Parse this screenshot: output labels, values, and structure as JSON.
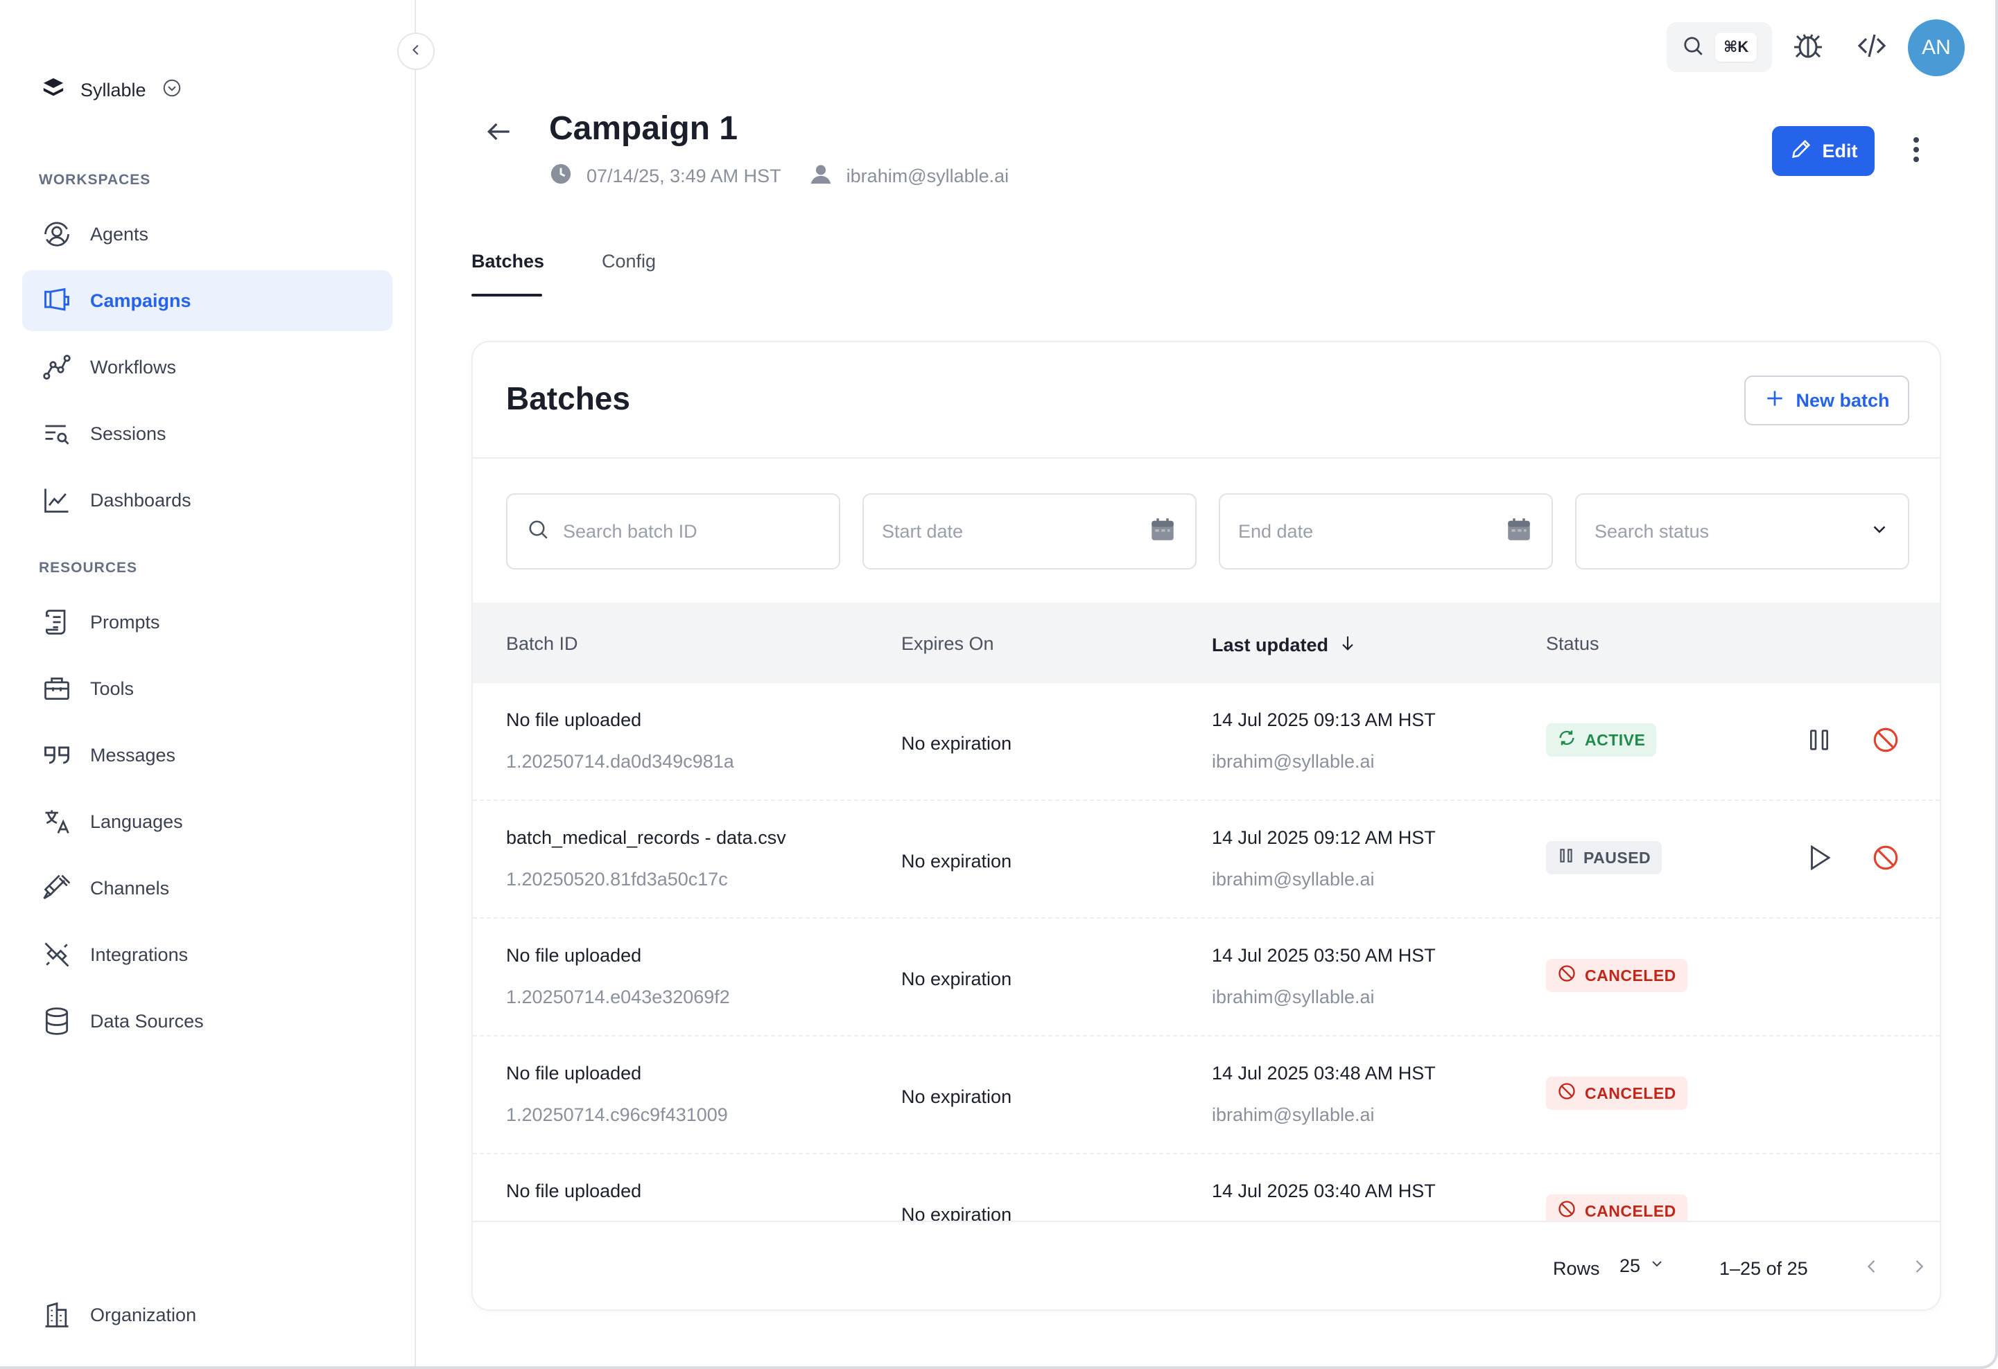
{
  "app": {
    "brand_name": "Syllable"
  },
  "sidebar": {
    "sections": [
      {
        "label": "WORKSPACES"
      },
      {
        "label": "RESOURCES"
      }
    ],
    "items": [
      {
        "label": "Agents",
        "icon": "agents-icon"
      },
      {
        "label": "Campaigns",
        "icon": "megaphone-icon",
        "active": true
      },
      {
        "label": "Workflows",
        "icon": "workflow-icon"
      },
      {
        "label": "Sessions",
        "icon": "list-search-icon"
      },
      {
        "label": "Dashboards",
        "icon": "chart-line-icon"
      },
      {
        "label": "Prompts",
        "icon": "scroll-icon"
      },
      {
        "label": "Tools",
        "icon": "toolbox-icon"
      },
      {
        "label": "Messages",
        "icon": "quote-icon"
      },
      {
        "label": "Languages",
        "icon": "language-icon"
      },
      {
        "label": "Channels",
        "icon": "plug-icon"
      },
      {
        "label": "Integrations",
        "icon": "integration-icon"
      },
      {
        "label": "Data Sources",
        "icon": "database-icon"
      }
    ],
    "footer_item": {
      "label": "Organization",
      "icon": "building-icon"
    }
  },
  "topbar": {
    "search_shortcut": "⌘K",
    "avatar_initials": "AN"
  },
  "header": {
    "title": "Campaign 1",
    "timestamp": "07/14/25, 3:49 AM HST",
    "owner": "ibrahim@syllable.ai",
    "edit_label": "Edit"
  },
  "tabs": [
    {
      "label": "Batches",
      "active": true
    },
    {
      "label": "Config",
      "active": false
    }
  ],
  "card": {
    "title": "Batches",
    "new_batch_label": "New batch",
    "filters": {
      "search_placeholder": "Search batch ID",
      "start_date_placeholder": "Start date",
      "end_date_placeholder": "End date",
      "status_placeholder": "Search status"
    },
    "columns": {
      "batch_id": "Batch ID",
      "expires_on": "Expires On",
      "last_updated": "Last updated",
      "status": "Status"
    },
    "rows": [
      {
        "name": "No file uploaded",
        "id": "1.20250714.da0d349c981a",
        "expires": "No expiration",
        "updated": "14 Jul 2025 09:13 AM HST",
        "user": "ibrahim@syllable.ai",
        "status": "ACTIVE"
      },
      {
        "name": "batch_medical_records - data.csv",
        "id": "1.20250520.81fd3a50c17c",
        "expires": "No expiration",
        "updated": "14 Jul 2025 09:12 AM HST",
        "user": "ibrahim@syllable.ai",
        "status": "PAUSED"
      },
      {
        "name": "No file uploaded",
        "id": "1.20250714.e043e32069f2",
        "expires": "No expiration",
        "updated": "14 Jul 2025 03:50 AM HST",
        "user": "ibrahim@syllable.ai",
        "status": "CANCELED"
      },
      {
        "name": "No file uploaded",
        "id": "1.20250714.c96c9f431009",
        "expires": "No expiration",
        "updated": "14 Jul 2025 03:48 AM HST",
        "user": "ibrahim@syllable.ai",
        "status": "CANCELED"
      },
      {
        "name": "No file uploaded",
        "id": "",
        "expires": "No expiration",
        "updated": "14 Jul 2025 03:40 AM HST",
        "user": "",
        "status": "CANCELED"
      }
    ],
    "footer": {
      "rows_label": "Rows",
      "rows_value": "25",
      "range_text": "1–25 of 25"
    }
  },
  "colors": {
    "accent": "#2563eb",
    "active_bg": "#e7f6ec",
    "active_fg": "#1f8a4c",
    "canceled_bg": "#fdecea",
    "canceled_fg": "#c0271b",
    "avatar_bg": "#4a9ad6"
  }
}
